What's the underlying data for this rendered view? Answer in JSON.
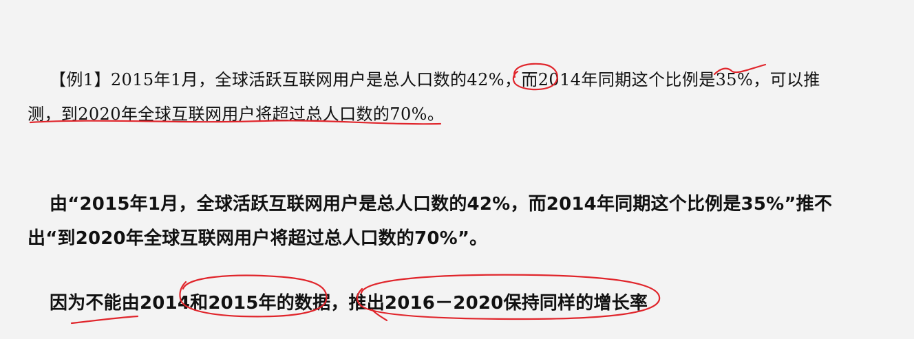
{
  "example": {
    "line1": "【例1】2015年1月，全球活跃互联网用户是总人口数的42%，而2014年同期这个比例是35%，可以推",
    "line2": "测，到2020年全球互联网用户将超过总人口数的70%。"
  },
  "analysis": {
    "line1": "由“2015年1月，全球活跃互联网用户是总人口数的42%，而2014年同期这个比例是35%”推不",
    "line2": "出“到2020年全球互联网用户将超过总人口数的70%”。"
  },
  "conclusion": {
    "text": "因为不能由2014和2015年的数据，推出2016－2020保持同样的增长率"
  },
  "annotation_color": "#e0252b"
}
